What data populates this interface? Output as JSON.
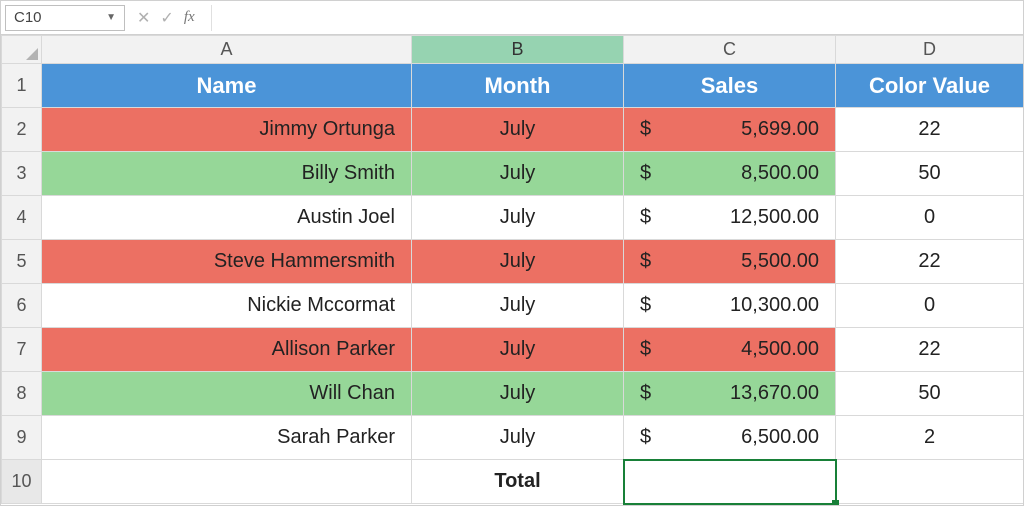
{
  "formula": {
    "nameboxValue": "C10",
    "fxLabel": "fx",
    "formulaValue": ""
  },
  "colLabels": {
    "A": "A",
    "B": "B",
    "C": "C",
    "D": "D"
  },
  "rowLabels": [
    "1",
    "2",
    "3",
    "4",
    "5",
    "6",
    "7",
    "8",
    "9",
    "10"
  ],
  "headers": {
    "name": "Name",
    "month": "Month",
    "sales": "Sales",
    "colorValue": "Color Value"
  },
  "currencySymbol": "$",
  "totalLabel": "Total",
  "rows": [
    {
      "name": "Jimmy Ortunga",
      "month": "July",
      "sales": "5,699.00",
      "colorValue": "22",
      "fill": "red"
    },
    {
      "name": "Billy Smith",
      "month": "July",
      "sales": "8,500.00",
      "colorValue": "50",
      "fill": "green"
    },
    {
      "name": "Austin Joel",
      "month": "July",
      "sales": "12,500.00",
      "colorValue": "0",
      "fill": "none"
    },
    {
      "name": "Steve Hammersmith",
      "month": "July",
      "sales": "5,500.00",
      "colorValue": "22",
      "fill": "red"
    },
    {
      "name": "Nickie Mccormat",
      "month": "July",
      "sales": "10,300.00",
      "colorValue": "0",
      "fill": "none"
    },
    {
      "name": "Allison Parker",
      "month": "July",
      "sales": "4,500.00",
      "colorValue": "22",
      "fill": "red"
    },
    {
      "name": "Will Chan",
      "month": "July",
      "sales": "13,670.00",
      "colorValue": "50",
      "fill": "green"
    },
    {
      "name": "Sarah Parker",
      "month": "July",
      "sales": "6,500.00",
      "colorValue": "2",
      "fill": "none"
    }
  ],
  "chart_data": {
    "type": "table",
    "title": "Sales by Name (July)",
    "columns": [
      "Name",
      "Month",
      "Sales",
      "Color Value"
    ],
    "records": [
      [
        "Jimmy Ortunga",
        "July",
        5699.0,
        22
      ],
      [
        "Billy Smith",
        "July",
        8500.0,
        50
      ],
      [
        "Austin Joel",
        "July",
        12500.0,
        0
      ],
      [
        "Steve Hammersmith",
        "July",
        5500.0,
        22
      ],
      [
        "Nickie Mccormat",
        "July",
        10300.0,
        0
      ],
      [
        "Allison Parker",
        "July",
        4500.0,
        22
      ],
      [
        "Will Chan",
        "July",
        13670.0,
        50
      ],
      [
        "Sarah Parker",
        "July",
        6500.0,
        2
      ]
    ]
  }
}
